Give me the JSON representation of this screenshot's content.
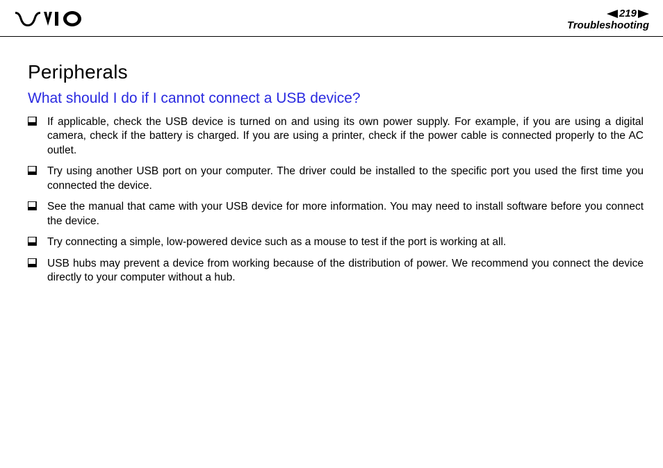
{
  "header": {
    "page_number": "219",
    "section": "Troubleshooting"
  },
  "content": {
    "heading": "Peripherals",
    "question": "What should I do if I cannot connect a USB device?",
    "items": [
      "If applicable, check the USB device is turned on and using its own power supply. For example, if you are using a digital camera, check if the battery is charged. If you are using a printer, check if the power cable is connected properly to the AC outlet.",
      "Try using another USB port on your computer. The driver could be installed to the specific port you used the first time you connected the device.",
      "See the manual that came with your USB device for more information. You may need to install software before you connect the device.",
      "Try connecting a simple, low-powered device such as a mouse to test if the port is working at all.",
      "USB hubs may prevent a device from working because of the distribution of power. We recommend you connect the device directly to your computer without a hub."
    ]
  }
}
